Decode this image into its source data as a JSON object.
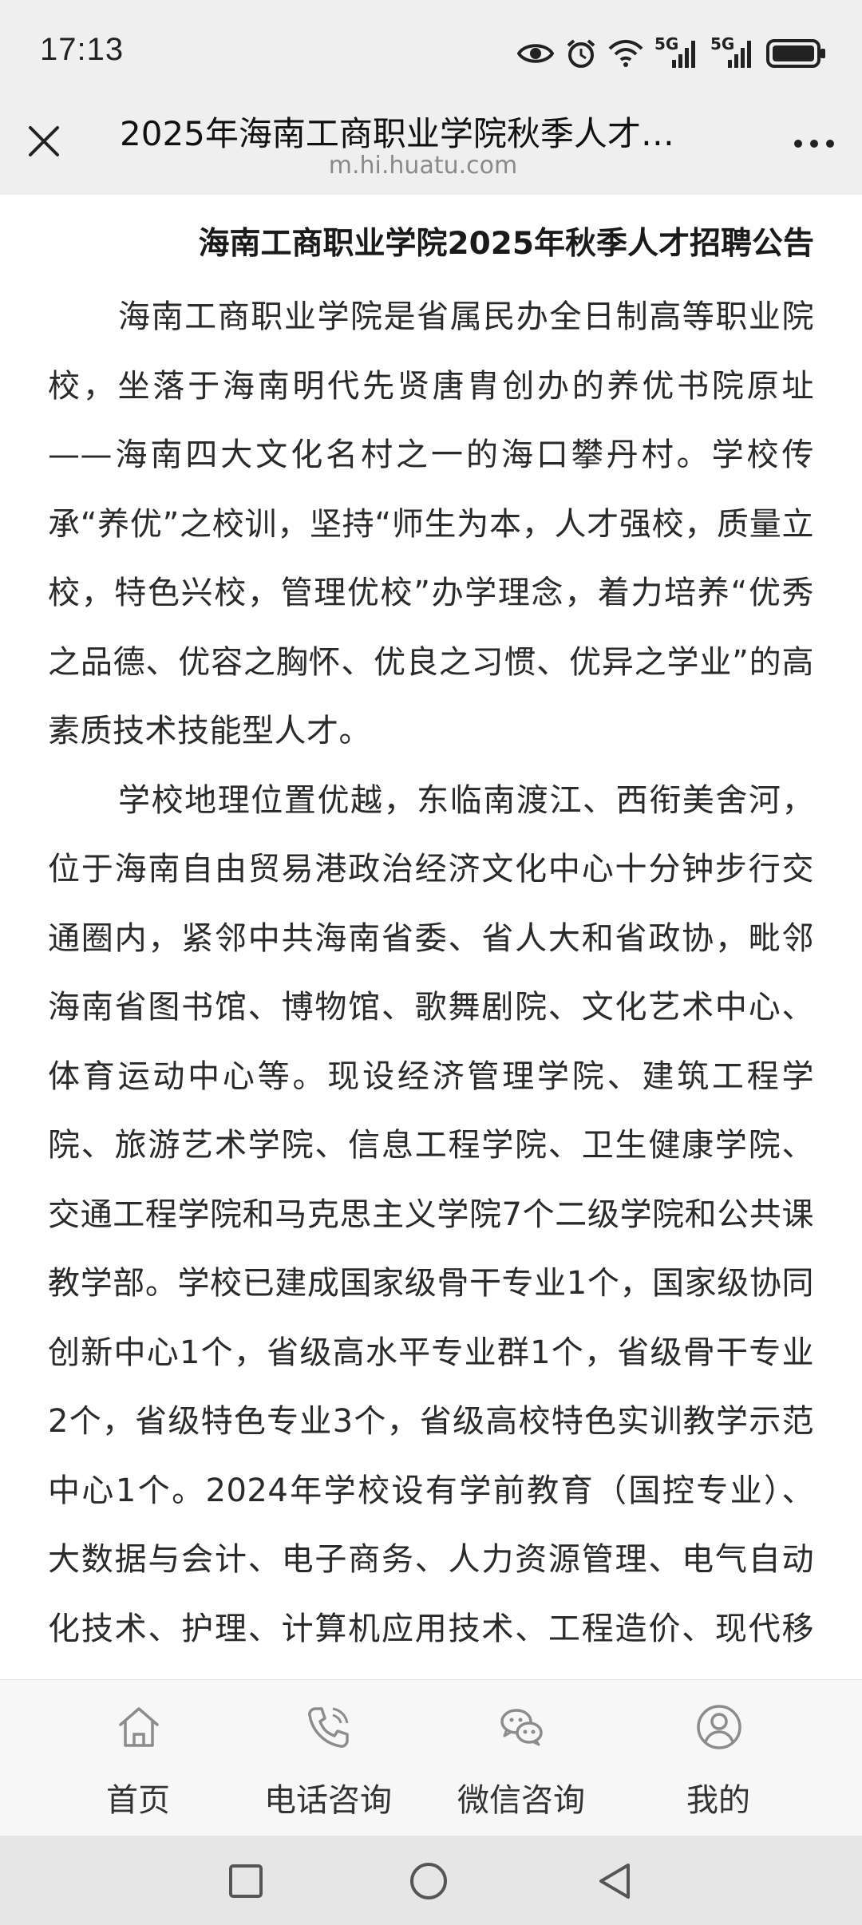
{
  "status_bar": {
    "time": "17:13",
    "icons": [
      "eye-comfort-icon",
      "alarm-icon",
      "wifi-icon",
      "signal-5g-icon",
      "signal-5g-icon",
      "battery-icon"
    ],
    "network_labels": [
      "5G",
      "5G"
    ]
  },
  "title_bar": {
    "title": "2025年海南工商职业学院秋季人才…",
    "url": "m.hi.huatu.com",
    "close_icon": "close-icon",
    "more_icon": "more-icon"
  },
  "article": {
    "heading": "海南工商职业学院2025年秋季人才招聘公告",
    "paragraphs": [
      "海南工商职业学院是省属民办全日制高等职业院校，坐落于海南明代先贤唐胄创办的养优书院原址——海南四大文化名村之一的海口攀丹村。学校传承“养优”之校训，坚持“师生为本，人才强校，质量立校，特色兴校，管理优校”办学理念，着力培养“优秀之品德、优容之胸怀、优良之习惯、优异之学业”的高素质技术技能型人才。",
      "学校地理位置优越，东临南渡江、西衔美舍河，位于海南自由贸易港政治经济文化中心十分钟步行交通圈内，紧邻中共海南省委、省人大和省政协，毗邻海南省图书馆、博物馆、歌舞剧院、文化艺术中心、体育运动中心等。现设经济管理学院、建筑工程学院、旅游艺术学院、信息工程学院、卫生健康学院、交通工程学院和马克思主义学院7个二级学院和公共课教学部。学校已建成国家级骨干专业1个，国家级协同创新中心1个，省级高水平专业群1个，省级骨干专业2个，省级特色专业3个，省级高校特色实训教学示范中心1个。2024年学校设有学前教育（国控专业）、大数据与会计、电子商务、人力资源管理、电气自动化技术、护理、计算机应用技术、工程造价、现代移动通信技术、新"
    ]
  },
  "bottom_nav": {
    "items": [
      {
        "label": "首页",
        "icon": "home-icon"
      },
      {
        "label": "电话咨询",
        "icon": "phone-icon"
      },
      {
        "label": "微信咨询",
        "icon": "wechat-icon"
      },
      {
        "label": "我的",
        "icon": "user-icon"
      }
    ]
  },
  "system_nav": {
    "buttons": [
      "recents-icon",
      "home-circle-icon",
      "back-icon"
    ]
  },
  "colors": {
    "bar_background": "#efefef",
    "page_background": "#ffffff",
    "text": "#2a2a2a",
    "url_text": "#8a8a8a",
    "nav_icon": "#8c8c8c"
  }
}
